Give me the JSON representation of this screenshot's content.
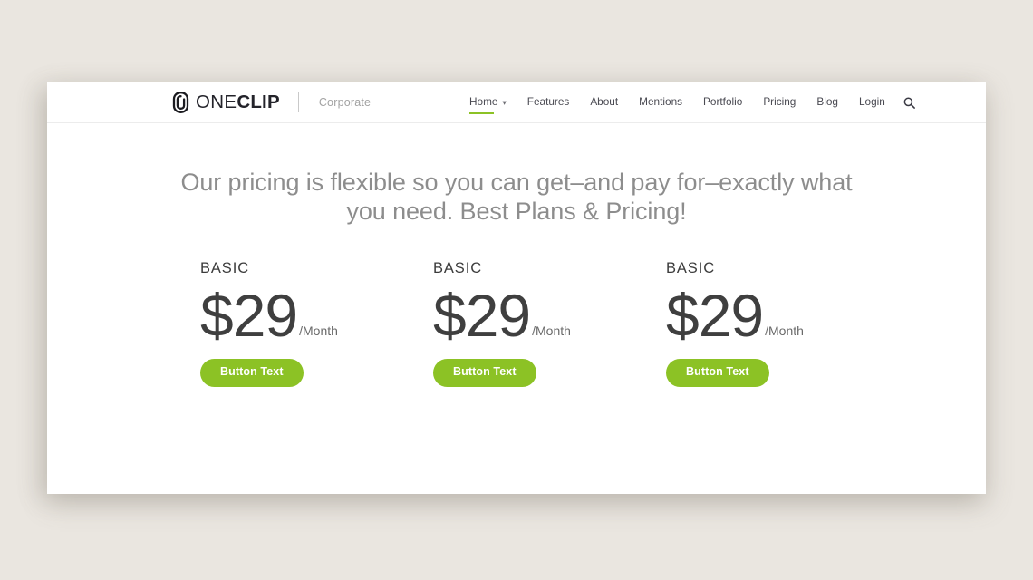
{
  "theme": {
    "page_background": "#eae6e0",
    "panel_background": "#ffffff",
    "accent_green": "#8cc225",
    "nav_text": "#4a4a52",
    "headline_text": "#8d8d8d",
    "divider": "#ececec"
  },
  "header": {
    "brand": {
      "mark_icon": "paperclip-icon",
      "name_light": "ONE",
      "name_bold": "CLIP",
      "tagline": "Corporate"
    },
    "nav_items": [
      {
        "label": "Home",
        "has_dropdown": true,
        "chevron_icon": "chevron-down-icon",
        "active": true
      },
      {
        "label": "Features",
        "has_dropdown": false,
        "active": false
      },
      {
        "label": "About",
        "has_dropdown": false,
        "active": false
      },
      {
        "label": "Mentions",
        "has_dropdown": false,
        "active": false
      },
      {
        "label": "Portfolio",
        "has_dropdown": false,
        "active": false
      },
      {
        "label": "Pricing",
        "has_dropdown": false,
        "active": false
      },
      {
        "label": "Blog",
        "has_dropdown": false,
        "active": false
      },
      {
        "label": "Login",
        "has_dropdown": false,
        "active": false
      }
    ],
    "search_icon": "search-icon"
  },
  "hero": {
    "headline": "Our pricing is flexible so you can get–and pay for–exactly what you need. Best Plans & Pricing!"
  },
  "pricing": {
    "plans": [
      {
        "title": "BASIC",
        "price": "$29",
        "period": "/Month",
        "button_label": "Button Text"
      },
      {
        "title": "BASIC",
        "price": "$29",
        "period": "/Month",
        "button_label": "Button Text"
      },
      {
        "title": "BASIC",
        "price": "$29",
        "period": "/Month",
        "button_label": "Button Text"
      }
    ]
  }
}
